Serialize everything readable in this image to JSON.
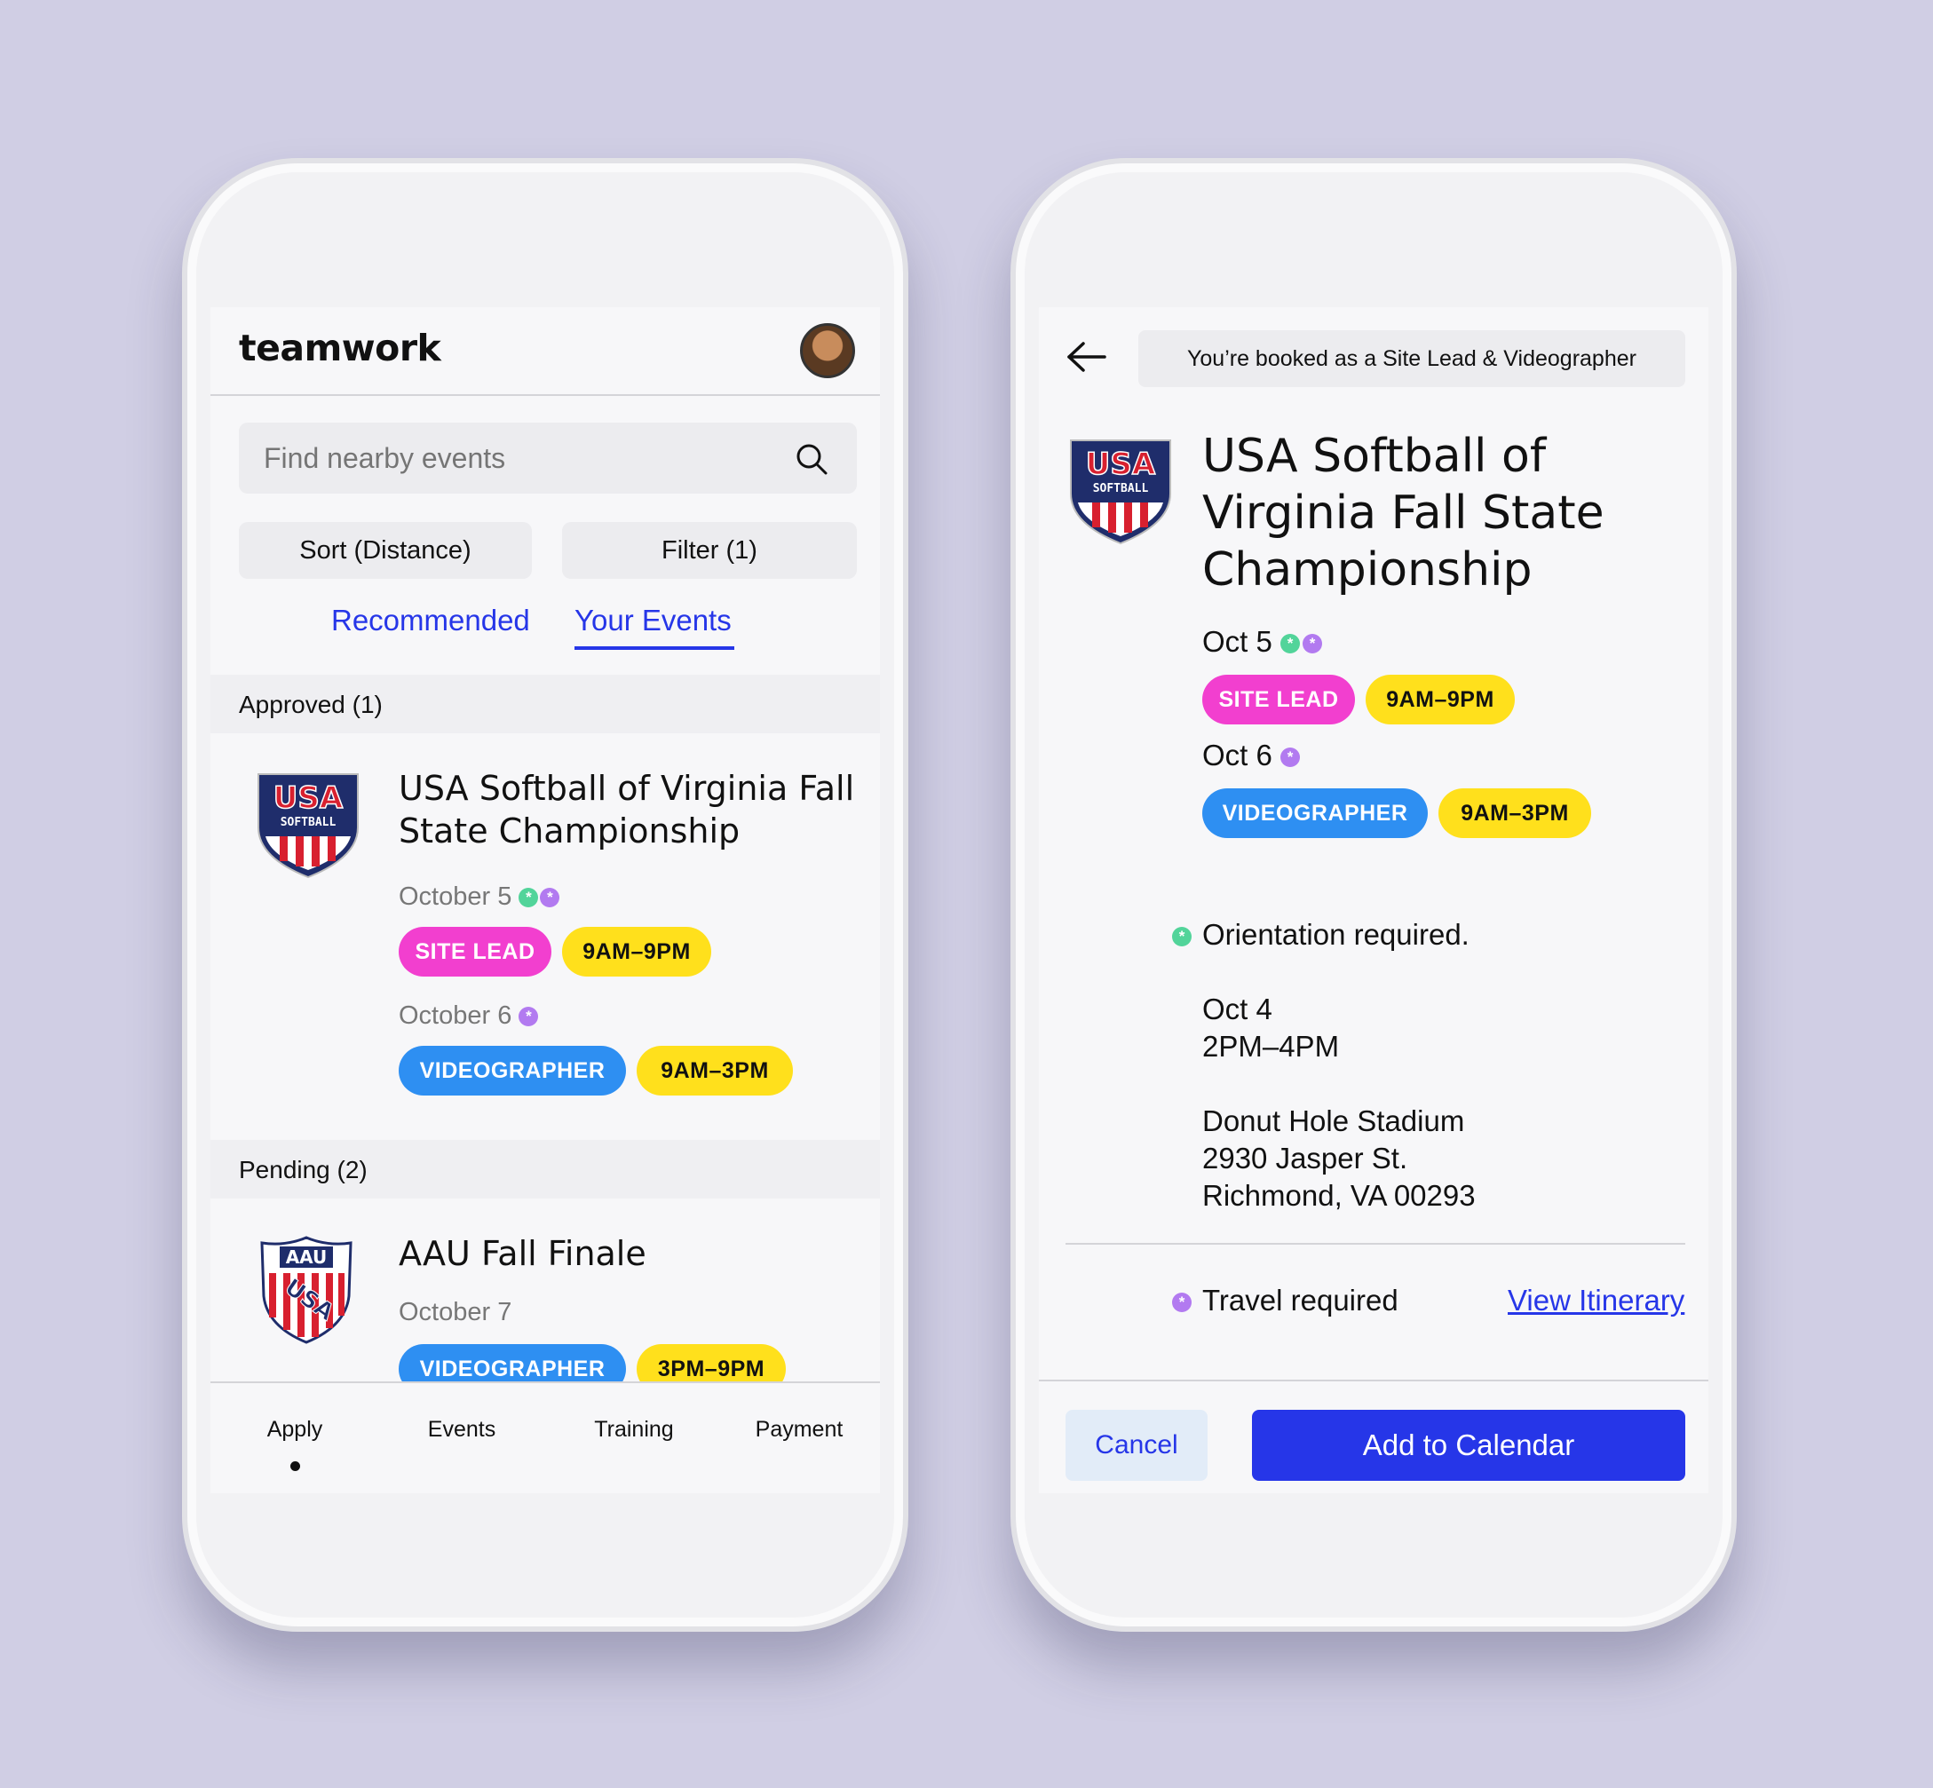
{
  "colors": {
    "accent_blue": "#2636e8",
    "site_lead_pink": "#f23fcf",
    "videographer_blue": "#2e8ff2",
    "time_yellow": "#ffe01c",
    "orientation_green": "#52d49a",
    "travel_purple": "#b27af0"
  },
  "left": {
    "brand": "teamwork",
    "search": {
      "placeholder": "Find nearby events",
      "icon": "search-icon"
    },
    "sort_label": "Sort (Distance)",
    "filter_label": "Filter (1)",
    "tabs": {
      "recommended": "Recommended",
      "your_events": "Your Events",
      "active": "Your Events"
    },
    "approved": {
      "header": "Approved (1)",
      "event": {
        "logo": {
          "line1": "USA",
          "line2": "SOFTBALL"
        },
        "title_line1": "USA Softball of Virginia Fall",
        "title_line2": "State Championship",
        "day1": {
          "date": "October 5",
          "role": "SITE LEAD",
          "time": "9AM–9PM"
        },
        "day2": {
          "date": "October 6",
          "role": "VIDEOGRAPHER",
          "time": "9AM–3PM"
        }
      }
    },
    "pending": {
      "header": "Pending (2)",
      "event": {
        "logo": {
          "line1": "AAU",
          "line2": "USA"
        },
        "title": "AAU Fall Finale",
        "date": "October 7",
        "role": "VIDEOGRAPHER",
        "time": "3PM–9PM"
      }
    },
    "nav": {
      "apply": "Apply",
      "events": "Events",
      "training": "Training",
      "payment": "Payment",
      "active": "Apply"
    }
  },
  "right": {
    "banner": "You’re booked as a Site Lead & Videographer",
    "back_icon": "arrow-left-icon",
    "logo": {
      "line1": "USA",
      "line2": "SOFTBALL"
    },
    "title_line1": "USA Softball of",
    "title_line2": "Virginia Fall State",
    "title_line3": "Championship",
    "day1": {
      "date": "Oct 5",
      "role": "SITE LEAD",
      "time": "9AM–9PM"
    },
    "day2": {
      "date": "Oct 6",
      "role": "VIDEOGRAPHER",
      "time": "9AM–3PM"
    },
    "orientation": {
      "label": "Orientation required.",
      "date": "Oct 4",
      "time": "2PM–4PM",
      "venue": "Donut Hole Stadium",
      "street": "2930 Jasper St.",
      "city": "Richmond, VA 00293"
    },
    "travel": {
      "label": "Travel required",
      "link": "View Itinerary"
    },
    "cancel_label": "Cancel",
    "add_label": "Add to Calendar"
  }
}
